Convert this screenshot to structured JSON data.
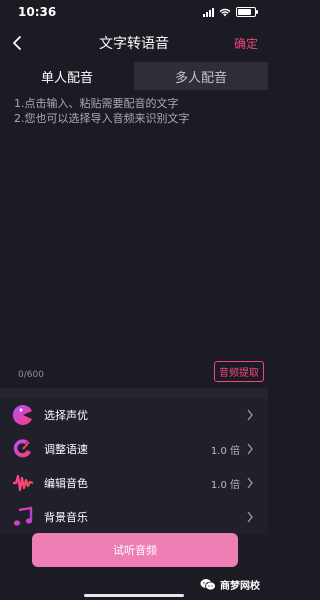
{
  "status_bar": {
    "time": "10:36"
  },
  "nav": {
    "title": "文字转语音",
    "confirm": "确定"
  },
  "tabs": [
    {
      "label": "单人配音",
      "active": true
    },
    {
      "label": "多人配音",
      "active": false
    }
  ],
  "editor": {
    "hint": "1.点击输入、粘贴需要配音的文字\n2.您也可以选择导入音频来识别文字",
    "counter": "0/600",
    "extract_button": "音频提取"
  },
  "options": [
    {
      "label": "选择声优",
      "value": "",
      "icon": "voice-actor-icon"
    },
    {
      "label": "调整语速",
      "value": "1.0 倍",
      "icon": "speed-icon"
    },
    {
      "label": "编辑音色",
      "value": "1.0 倍",
      "icon": "timbre-icon"
    },
    {
      "label": "背景音乐",
      "value": "",
      "icon": "music-note-icon"
    }
  ],
  "try_listen": "试听音频",
  "watermark": "商梦网校",
  "colors": {
    "accent": "#f0457d",
    "button": "#ee7fb5",
    "background": "#1b1b24"
  }
}
